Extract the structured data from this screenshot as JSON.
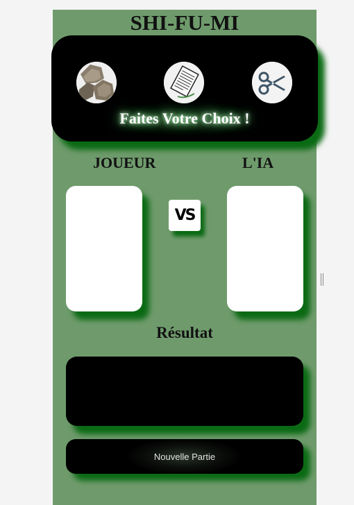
{
  "app": {
    "title": "SHI-FU-MI"
  },
  "choices": {
    "prompt": "Faites Votre Choix !",
    "items": [
      {
        "id": "rock",
        "icon": "rock-icon"
      },
      {
        "id": "paper",
        "icon": "paper-icon"
      },
      {
        "id": "scissors",
        "icon": "scissors-icon"
      }
    ]
  },
  "arena": {
    "player_label": "JOUEUR",
    "ai_label": "L'IA",
    "vs_label": "VS"
  },
  "result": {
    "title": "Résultat",
    "text": ""
  },
  "actions": {
    "new_game_label": "Nouvelle Partie"
  },
  "colors": {
    "background": "#6f9b6c",
    "panel": "#000000",
    "shadow": "#0b6a14",
    "card": "#ffffff"
  }
}
